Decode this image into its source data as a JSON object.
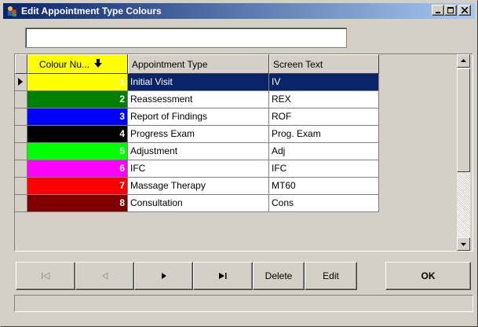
{
  "window": {
    "title": "Edit Appointment Type Colours"
  },
  "search": {
    "value": "",
    "placeholder": ""
  },
  "grid": {
    "columns": [
      "Colour Nu...",
      "Appointment Type",
      "Screen Text"
    ],
    "sort_column": "Colour Nu...",
    "rows": [
      {
        "number": "1",
        "color": "#ffff00",
        "type": "Initial Visit",
        "screen_text": "IV",
        "selected": true
      },
      {
        "number": "2",
        "color": "#007f00",
        "type": "Reassessment",
        "screen_text": "REX"
      },
      {
        "number": "3",
        "color": "#0000ff",
        "type": "Report of Findings",
        "screen_text": "ROF"
      },
      {
        "number": "4",
        "color": "#000000",
        "type": "Progress Exam",
        "screen_text": "Prog. Exam"
      },
      {
        "number": "5",
        "color": "#00ff00",
        "type": "Adjustment",
        "screen_text": "Adj"
      },
      {
        "number": "6",
        "color": "#ff00ff",
        "type": "IFC",
        "screen_text": "IFC"
      },
      {
        "number": "7",
        "color": "#ff0000",
        "type": "Massage Therapy",
        "screen_text": "MT60"
      },
      {
        "number": "8",
        "color": "#7f0000",
        "type": "Consultation",
        "screen_text": "Cons"
      }
    ]
  },
  "navigator": {
    "first_icon": "skip-first-icon",
    "prior_icon": "previous-icon",
    "next_icon": "next-icon",
    "last_icon": "skip-last-icon",
    "delete_label": "Delete",
    "edit_label": "Edit"
  },
  "ok_label": "OK",
  "statusbar": {
    "text": ""
  },
  "colors": {
    "titlebar_start": "#0a246a",
    "titlebar_end": "#a6caf0",
    "selection": "#0a246a",
    "face": "#d4d0c8"
  }
}
